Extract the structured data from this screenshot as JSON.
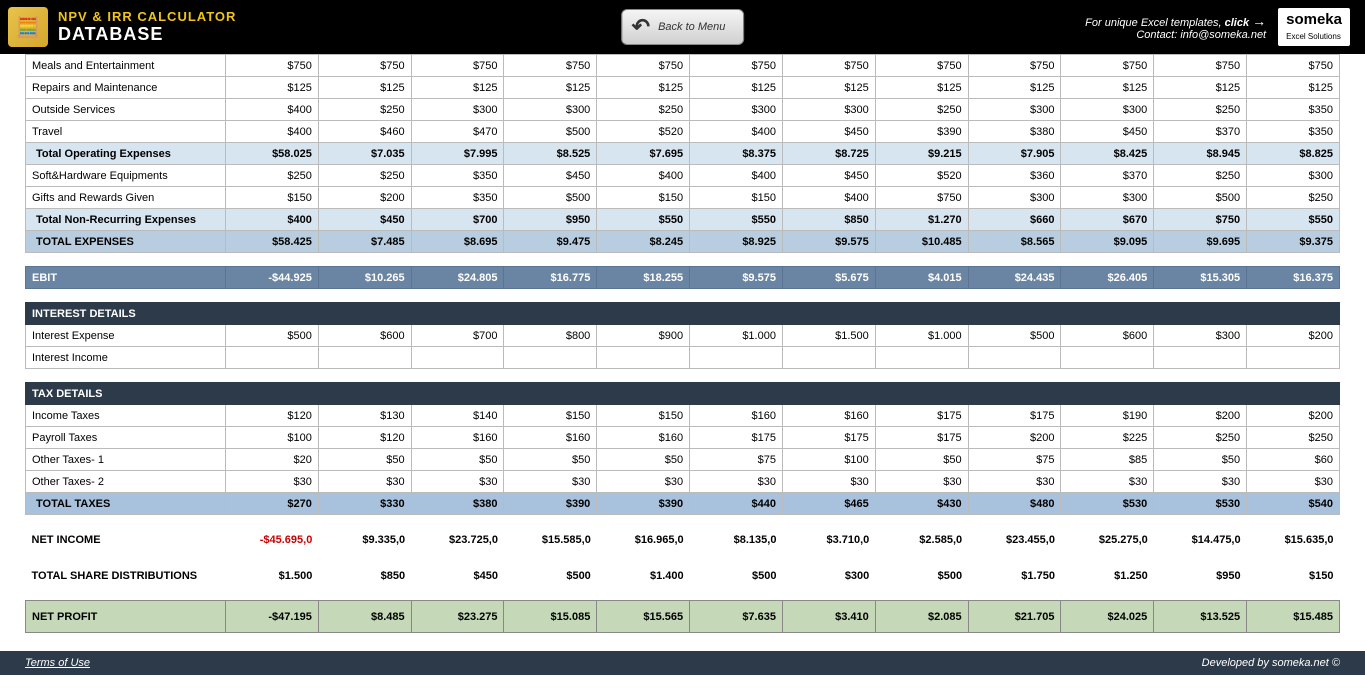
{
  "header": {
    "app_title": "NPV & IRR CALCULATOR",
    "section_title": "DATABASE",
    "back_button": "Back to Menu",
    "tagline": "For unique Excel templates,",
    "click": "click",
    "contact": "Contact: info@someka.net",
    "brand": "someka",
    "brand_sub": "Excel Solutions"
  },
  "rows": {
    "meals": {
      "label": "Meals and Entertainment",
      "v": [
        "$750",
        "$750",
        "$750",
        "$750",
        "$750",
        "$750",
        "$750",
        "$750",
        "$750",
        "$750",
        "$750",
        "$750"
      ]
    },
    "repairs": {
      "label": "Repairs and Maintenance",
      "v": [
        "$125",
        "$125",
        "$125",
        "$125",
        "$125",
        "$125",
        "$125",
        "$125",
        "$125",
        "$125",
        "$125",
        "$125"
      ]
    },
    "outside": {
      "label": "Outside Services",
      "v": [
        "$400",
        "$250",
        "$300",
        "$300",
        "$250",
        "$300",
        "$300",
        "$250",
        "$300",
        "$300",
        "$250",
        "$350"
      ]
    },
    "travel": {
      "label": "Travel",
      "v": [
        "$400",
        "$460",
        "$470",
        "$500",
        "$520",
        "$400",
        "$450",
        "$390",
        "$380",
        "$450",
        "$370",
        "$350"
      ]
    },
    "totop": {
      "label": "Total Operating Expenses",
      "v": [
        "$58.025",
        "$7.035",
        "$7.995",
        "$8.525",
        "$7.695",
        "$8.375",
        "$8.725",
        "$9.215",
        "$7.905",
        "$8.425",
        "$8.945",
        "$8.825"
      ]
    },
    "soft": {
      "label": "Soft&Hardware Equipments",
      "v": [
        "$250",
        "$250",
        "$350",
        "$450",
        "$400",
        "$400",
        "$450",
        "$520",
        "$360",
        "$370",
        "$250",
        "$300"
      ]
    },
    "gifts": {
      "label": "Gifts and Rewards Given",
      "v": [
        "$150",
        "$200",
        "$350",
        "$500",
        "$150",
        "$150",
        "$400",
        "$750",
        "$300",
        "$300",
        "$500",
        "$250"
      ]
    },
    "totnr": {
      "label": "Total Non-Recurring Expenses",
      "v": [
        "$400",
        "$450",
        "$700",
        "$950",
        "$550",
        "$550",
        "$850",
        "$1.270",
        "$660",
        "$670",
        "$750",
        "$550"
      ]
    },
    "totexp": {
      "label": "TOTAL EXPENSES",
      "v": [
        "$58.425",
        "$7.485",
        "$8.695",
        "$9.475",
        "$8.245",
        "$8.925",
        "$9.575",
        "$10.485",
        "$8.565",
        "$9.095",
        "$9.695",
        "$9.375"
      ]
    },
    "ebit": {
      "label": "EBIT",
      "v": [
        "-$44.925",
        "$10.265",
        "$24.805",
        "$16.775",
        "$18.255",
        "$9.575",
        "$5.675",
        "$4.015",
        "$24.435",
        "$26.405",
        "$15.305",
        "$16.375"
      ]
    },
    "inthead": {
      "label": "INTEREST DETAILS"
    },
    "intexp": {
      "label": "Interest Expense",
      "v": [
        "$500",
        "$600",
        "$700",
        "$800",
        "$900",
        "$1.000",
        "$1.500",
        "$1.000",
        "$500",
        "$600",
        "$300",
        "$200"
      ]
    },
    "intinc": {
      "label": "Interest Income",
      "v": [
        "",
        "",
        "",
        "",
        "",
        "",
        "",
        "",
        "",
        "",
        "",
        ""
      ]
    },
    "taxhead": {
      "label": "TAX DETAILS"
    },
    "inctax": {
      "label": "Income Taxes",
      "v": [
        "$120",
        "$130",
        "$140",
        "$150",
        "$150",
        "$160",
        "$160",
        "$175",
        "$175",
        "$190",
        "$200",
        "$200"
      ]
    },
    "paytax": {
      "label": "Payroll Taxes",
      "v": [
        "$100",
        "$120",
        "$160",
        "$160",
        "$160",
        "$175",
        "$175",
        "$175",
        "$200",
        "$225",
        "$250",
        "$250"
      ]
    },
    "ot1": {
      "label": "Other Taxes- 1",
      "v": [
        "$20",
        "$50",
        "$50",
        "$50",
        "$50",
        "$75",
        "$100",
        "$50",
        "$75",
        "$85",
        "$50",
        "$60"
      ]
    },
    "ot2": {
      "label": "Other Taxes- 2",
      "v": [
        "$30",
        "$30",
        "$30",
        "$30",
        "$30",
        "$30",
        "$30",
        "$30",
        "$30",
        "$30",
        "$30",
        "$30"
      ]
    },
    "tottax": {
      "label": "TOTAL TAXES",
      "v": [
        "$270",
        "$330",
        "$380",
        "$390",
        "$390",
        "$440",
        "$465",
        "$430",
        "$480",
        "$530",
        "$530",
        "$540"
      ]
    },
    "netinc": {
      "label": "NET INCOME",
      "v": [
        "-$45.695,0",
        "$9.335,0",
        "$23.725,0",
        "$15.585,0",
        "$16.965,0",
        "$8.135,0",
        "$3.710,0",
        "$2.585,0",
        "$23.455,0",
        "$25.275,0",
        "$14.475,0",
        "$15.635,0"
      ]
    },
    "tsd": {
      "label": "TOTAL SHARE DISTRIBUTIONS",
      "v": [
        "$1.500",
        "$850",
        "$450",
        "$500",
        "$1.400",
        "$500",
        "$300",
        "$500",
        "$1.750",
        "$1.250",
        "$950",
        "$150"
      ]
    },
    "netprofit": {
      "label": "NET PROFIT",
      "v": [
        "-$47.195",
        "$8.485",
        "$23.275",
        "$15.085",
        "$15.565",
        "$7.635",
        "$3.410",
        "$2.085",
        "$21.705",
        "$24.025",
        "$13.525",
        "$15.485"
      ]
    }
  },
  "footer": {
    "terms": "Terms of Use",
    "dev": "Developed by someka.net ©"
  }
}
